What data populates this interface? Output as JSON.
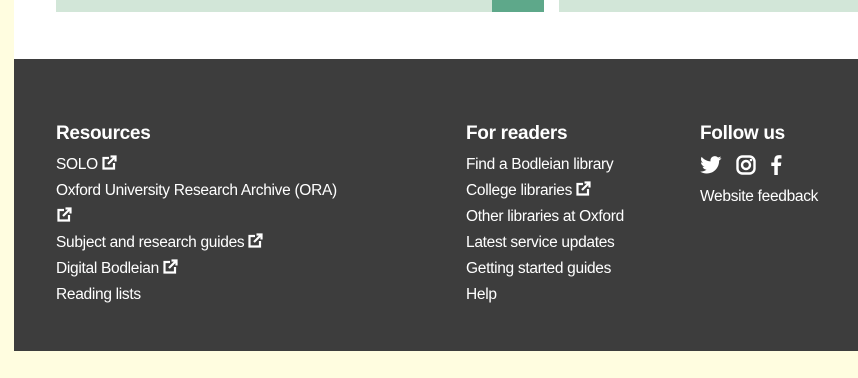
{
  "footer": {
    "resources": {
      "heading": "Resources",
      "items": [
        {
          "label": "SOLO",
          "external": true
        },
        {
          "label": "Oxford University Research Archive (ORA)",
          "external": true
        },
        {
          "label": "Subject and research guides",
          "external": true
        },
        {
          "label": "Digital Bodleian",
          "external": true
        },
        {
          "label": "Reading lists",
          "external": false
        }
      ]
    },
    "readers": {
      "heading": "For readers",
      "items": [
        {
          "label": "Find a Bodleian library",
          "external": false
        },
        {
          "label": "College libraries",
          "external": true
        },
        {
          "label": "Other libraries at Oxford",
          "external": false
        },
        {
          "label": "Latest service updates",
          "external": false
        },
        {
          "label": "Getting started guides",
          "external": false
        },
        {
          "label": "Help",
          "external": false
        }
      ]
    },
    "follow": {
      "heading": "Follow us",
      "social_icons": [
        "twitter-icon",
        "instagram-icon",
        "facebook-icon"
      ],
      "feedback_label": "Website feedback"
    }
  },
  "colors": {
    "footer_bg": "#3d3d3d",
    "page_margin": "#fffde0",
    "card_strip": "#d2e6d8",
    "card_accent": "#5ea88a",
    "text": "#ffffff"
  }
}
